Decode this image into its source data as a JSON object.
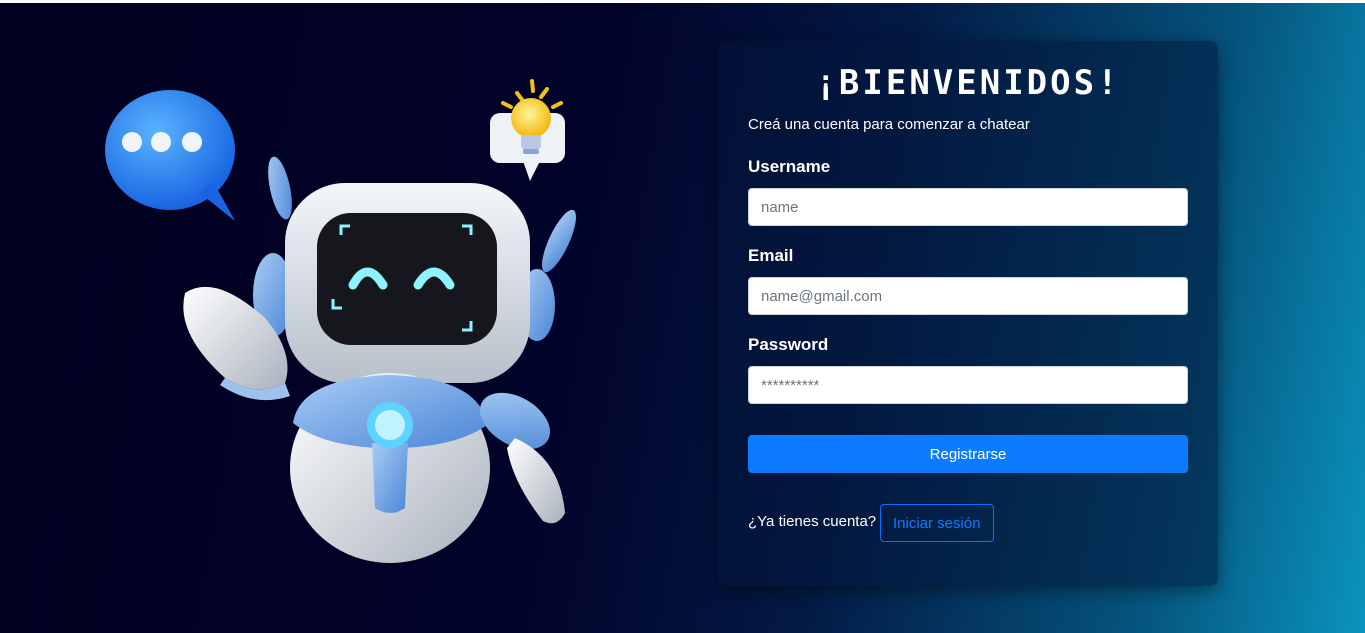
{
  "hero": {
    "illustration_icon": "robot-icon",
    "chat_bubble_icon": "chat-bubble-icon",
    "lightbulb_icon": "lightbulb-icon"
  },
  "form": {
    "title": "¡BIENVENIDOS!",
    "subtitle": "Creá una cuenta para comenzar a chatear",
    "username": {
      "label": "Username",
      "placeholder": "name",
      "value": ""
    },
    "email": {
      "label": "Email",
      "placeholder": "name@gmail.com",
      "value": ""
    },
    "password": {
      "label": "Password",
      "placeholder": "**********",
      "value": ""
    },
    "submit_label": "Registrarse",
    "login_prompt": "¿Ya tienes cuenta?",
    "login_label": "Iniciar sesión"
  },
  "colors": {
    "primary": "#0d7bff",
    "background_dark": "#01001f",
    "background_light": "#0a94bd"
  }
}
